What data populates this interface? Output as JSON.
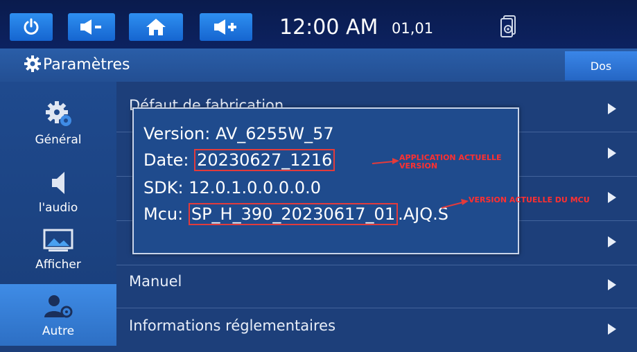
{
  "statusbar": {
    "time": "12:00 AM",
    "date": "01,01",
    "icons": [
      "power-icon",
      "volume-down-icon",
      "home-icon",
      "volume-up-icon",
      "phone-settings-icon"
    ]
  },
  "header": {
    "title": "Paramètres",
    "back_label": "Dos"
  },
  "sidebar": {
    "items": [
      {
        "label": "Général",
        "icon": "gear-icon"
      },
      {
        "label": "l'audio",
        "icon": "speaker-icon"
      },
      {
        "label": "Afficher",
        "icon": "display-icon"
      },
      {
        "label": "Autre",
        "icon": "user-settings-icon",
        "selected": true
      }
    ]
  },
  "list": {
    "items": [
      {
        "label": "Défaut de fabrication"
      },
      {
        "label": ""
      },
      {
        "label": ""
      },
      {
        "label": ""
      },
      {
        "label": "Manuel"
      },
      {
        "label": "Informations réglementaires"
      }
    ]
  },
  "popup": {
    "version": "Version: AV_6255W_57",
    "date_prefix": "Date: ",
    "date_value": "20230627_1216",
    "sdk": "SDK: 12.0.1.0.0.0.0.0",
    "mcu_prefix": "Mcu: ",
    "mcu_value": "SP_H_390_20230617_01",
    "mcu_suffix": ".AJQ.S"
  },
  "annotations": {
    "app_version_line1": "APPLICATION ACTUELLE",
    "app_version_line2": "VERSION",
    "mcu_version": "VERSION ACTUELLE DU MCU",
    "color": "#ff3030"
  },
  "colors": {
    "background": "#1d3f7a",
    "button_blue": "#1e78e0",
    "annotation_red": "#e33b3b"
  }
}
